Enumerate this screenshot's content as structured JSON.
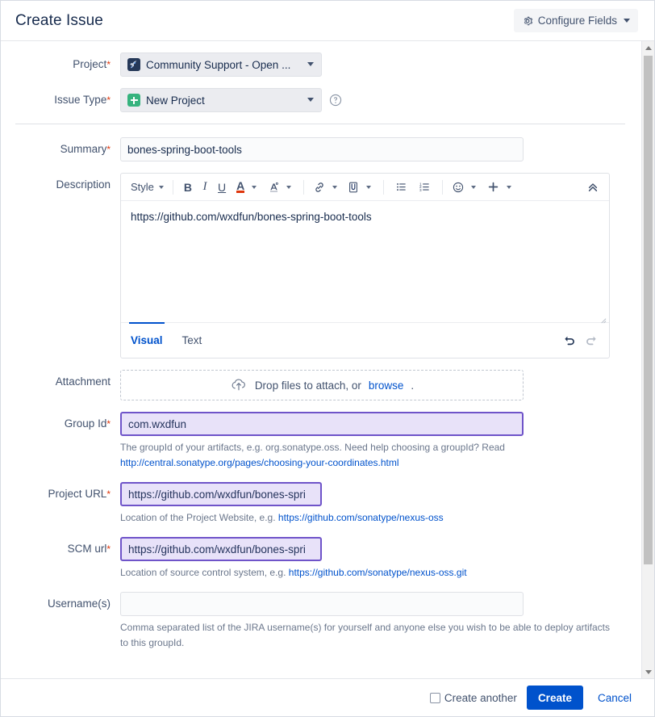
{
  "header": {
    "title": "Create Issue",
    "configure_fields_label": "Configure Fields",
    "gear_icon": "gear-icon",
    "caret_icon": "chevron-down-icon"
  },
  "fields": {
    "project": {
      "label": "Project",
      "required": "*",
      "value": "Community Support - Open ...",
      "icon": "rocket-icon"
    },
    "issue_type": {
      "label": "Issue Type",
      "required": "*",
      "value": "New Project",
      "icon": "plus-square-icon",
      "help_icon": "question-circle-icon"
    },
    "summary": {
      "label": "Summary",
      "required": "*",
      "value": "bones-spring-boot-tools"
    },
    "description": {
      "label": "Description",
      "body": "https://github.com/wxdfun/bones-spring-boot-tools",
      "toolbar": {
        "style_label": "Style",
        "bold": "B",
        "italic": "I",
        "underline": "U",
        "text_color": "A",
        "text_highlight": "A",
        "link_icon": "link-icon",
        "attach_icon": "paperclip-icon",
        "bullet_list_icon": "bullet-list-icon",
        "numbered_list_icon": "numbered-list-icon",
        "emoji_icon": "emoji-icon",
        "plus_icon": "plus-icon",
        "collapse_icon": "double-chevron-up-icon"
      },
      "tabs": [
        {
          "label": "Visual",
          "active": true
        },
        {
          "label": "Text",
          "active": false
        }
      ],
      "undo_icon": "undo-icon",
      "redo_icon": "redo-icon"
    },
    "attachment": {
      "label": "Attachment",
      "drop_text": "Drop files to attach, or",
      "browse_link": "browse",
      "trailing_period": ".",
      "cloud_icon": "cloud-upload-icon"
    },
    "group_id": {
      "label": "Group Id",
      "required": "*",
      "value": "com.wxdfun",
      "hint_text": "The groupId of your artifacts, e.g. org.sonatype.oss. Need help choosing a groupId? Read",
      "hint_link": "http://central.sonatype.org/pages/choosing-your-coordinates.html"
    },
    "project_url": {
      "label": "Project URL",
      "required": "*",
      "value": "https://github.com/wxdfun/bones-spri",
      "hint_prefix": "Location of the Project Website, e.g.",
      "hint_link": "https://github.com/sonatype/nexus-oss"
    },
    "scm_url": {
      "label": "SCM url",
      "required": "*",
      "value": "https://github.com/wxdfun/bones-spri",
      "hint_prefix": "Location of source control system, e.g.",
      "hint_link": "https://github.com/sonatype/nexus-oss.git"
    },
    "usernames": {
      "label": "Username(s)",
      "value": "",
      "placeholder": "",
      "hint_text": "Comma separated list of the JIRA username(s) for yourself and anyone else you wish to be able to deploy artifacts to this groupId."
    }
  },
  "footer": {
    "create_another_label": "Create another",
    "create_another_checked": false,
    "create_label": "Create",
    "cancel_label": "Cancel"
  },
  "colors": {
    "accent": "#0052CC",
    "required": "#DE350B",
    "autofill_bg": "#e8e2f9",
    "autofill_border": "#6f54c9",
    "issue_type_green": "#36B37E",
    "project_icon_navy": "#253858"
  }
}
